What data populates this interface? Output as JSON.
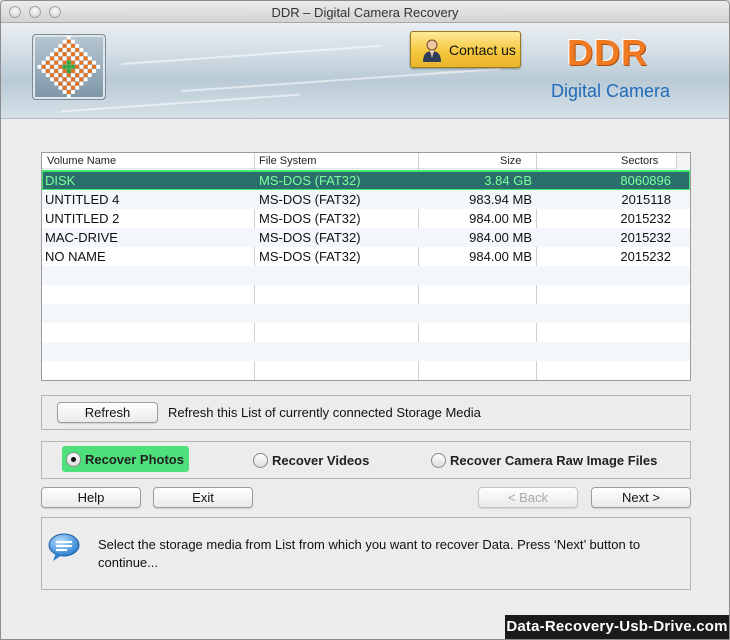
{
  "window": {
    "title": "DDR – Digital Camera Recovery"
  },
  "banner": {
    "contact_label": "Contact us",
    "brand": "DDR",
    "product": "Digital Camera"
  },
  "list": {
    "columns": [
      "Volume Name",
      "File System",
      "Size",
      "Sectors"
    ],
    "rows": [
      {
        "name": "DISK",
        "fs": "MS-DOS (FAT32)",
        "size": "3.84  GB",
        "sectors": "8060896",
        "selected": true
      },
      {
        "name": "UNTITLED 4",
        "fs": "MS-DOS (FAT32)",
        "size": "983.94  MB",
        "sectors": "2015118"
      },
      {
        "name": "UNTITLED 2",
        "fs": "MS-DOS (FAT32)",
        "size": "984.00  MB",
        "sectors": "2015232"
      },
      {
        "name": "MAC-DRIVE",
        "fs": "MS-DOS (FAT32)",
        "size": "984.00  MB",
        "sectors": "2015232"
      },
      {
        "name": "NO NAME",
        "fs": "MS-DOS (FAT32)",
        "size": "984.00  MB",
        "sectors": "2015232"
      }
    ]
  },
  "refresh": {
    "button_label": "Refresh",
    "description": "Refresh this List of currently connected Storage Media"
  },
  "recover_options": {
    "photos": "Recover Photos",
    "videos": "Recover Videos",
    "raw": "Recover Camera Raw Image Files",
    "selected": "photos"
  },
  "nav": {
    "help": "Help",
    "exit": "Exit",
    "back": "< Back",
    "next": "Next >"
  },
  "info": {
    "message": "Select the storage media from List from which you want to recover Data. Press ‘Next’ button to continue..."
  },
  "watermark": "Data-Recovery-Usb-Drive.com",
  "colors": {
    "selection_bg": "#2a6f6c",
    "selection_text": "#7cff9b",
    "highlight_green": "#4ee07a",
    "brand_orange": "#f07a22",
    "brand_blue": "#1f6bb8",
    "contact_gold": "#f4c73e"
  }
}
